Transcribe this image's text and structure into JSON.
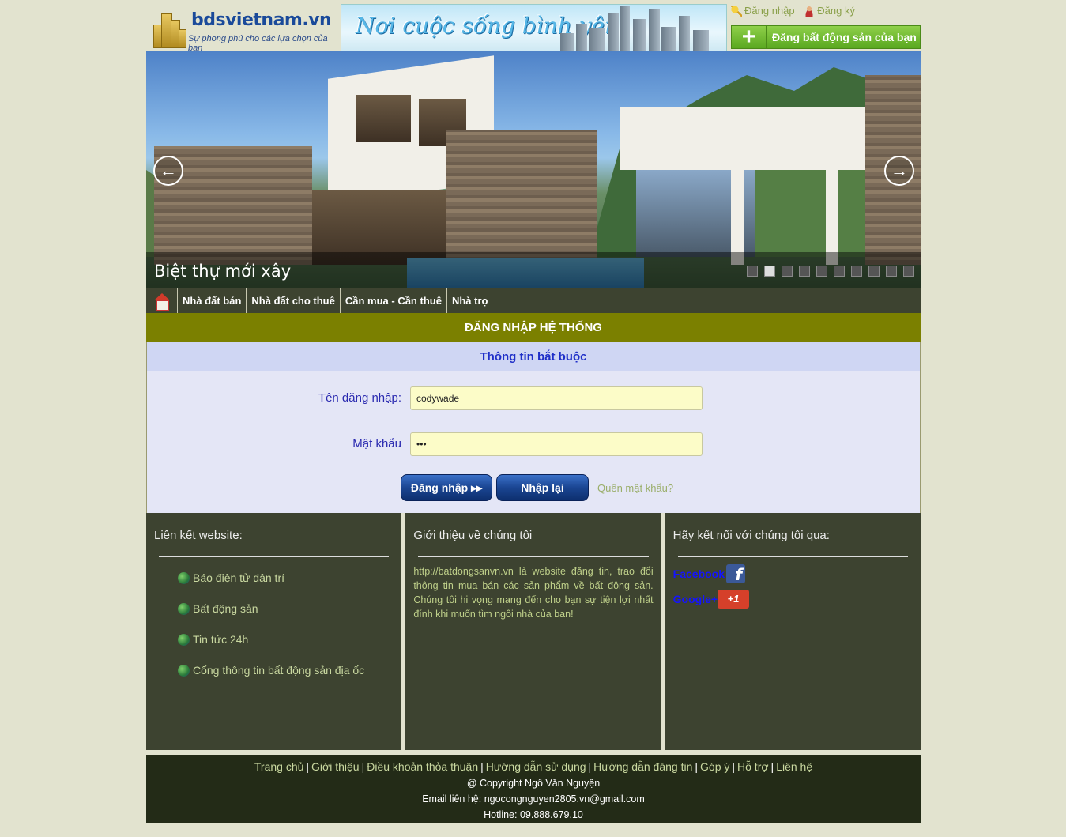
{
  "header": {
    "logo_text": "bdsvietnam.vn",
    "logo_slogan": "Sự phong phú cho các lựa chọn của bạn",
    "logo_vertical": "bdsvietnam.vn",
    "banner_slogan": "Nơi cuộc sống bình yên",
    "login_link": "Đăng nhập",
    "register_link": "Đăng ký",
    "post_button": "Đăng bất động sản của bạn"
  },
  "slider": {
    "caption": "Biệt thự mới xây",
    "dot_count": 10,
    "active_dot": 2
  },
  "nav": {
    "items": [
      "Nhà đất bán",
      "Nhà đất cho thuê",
      "Cần mua - Cần thuê",
      "Nhà trọ"
    ]
  },
  "login": {
    "title": "ĐĂNG NHẬP HỆ THỐNG",
    "subtitle": "Thông tin bắt buộc",
    "username_label": "Tên đăng nhập:",
    "username_value": "codywade",
    "password_label": "Mật khẩu",
    "password_value": "•••",
    "submit": "Đăng nhập ▸▸",
    "reset": "Nhập lại",
    "forgot": "Quên mật khẩu?"
  },
  "links_col": {
    "title": "Liên kết website:",
    "items": [
      "Báo điện tử dân trí",
      "Bất động sản",
      "Tin tức 24h",
      "Cổng thông tin bất động sản địa ốc"
    ]
  },
  "about_col": {
    "title": "Giới thiệu về chúng tôi",
    "text": "http://batdongsanvn.vn là website đăng tin, trao đổi thông tin mua bán các sản phẩm về bất động sản. Chúng tôi hi vọng mang đến cho bạn sự tiện lợi nhất đính khi muốn tìm ngôi nhà của ban!"
  },
  "social_col": {
    "title": "Hãy kết nối với chúng tôi qua:",
    "facebook": "Facebook",
    "google": "Google+",
    "google_badge": "+1"
  },
  "footer": {
    "links": [
      "Trang chủ",
      "Giới thiệu",
      "Điều khoản thỏa thuận",
      "Hướng dẫn sử dụng",
      "Hướng dẫn đăng tin",
      "Góp ý",
      "Hỗ trợ",
      "Liên hệ"
    ],
    "copyright": "@ Copyright Ngô Văn Nguyện",
    "email": "Email liên hệ: ngocongnguyen2805.vn@gmail.com",
    "hotline": "Hotline: 09.888.679.10"
  },
  "colors": {
    "background": "#e2e3cf",
    "nav": "#3d4330",
    "login_head": "#7b8000",
    "footer": "#232b17"
  }
}
